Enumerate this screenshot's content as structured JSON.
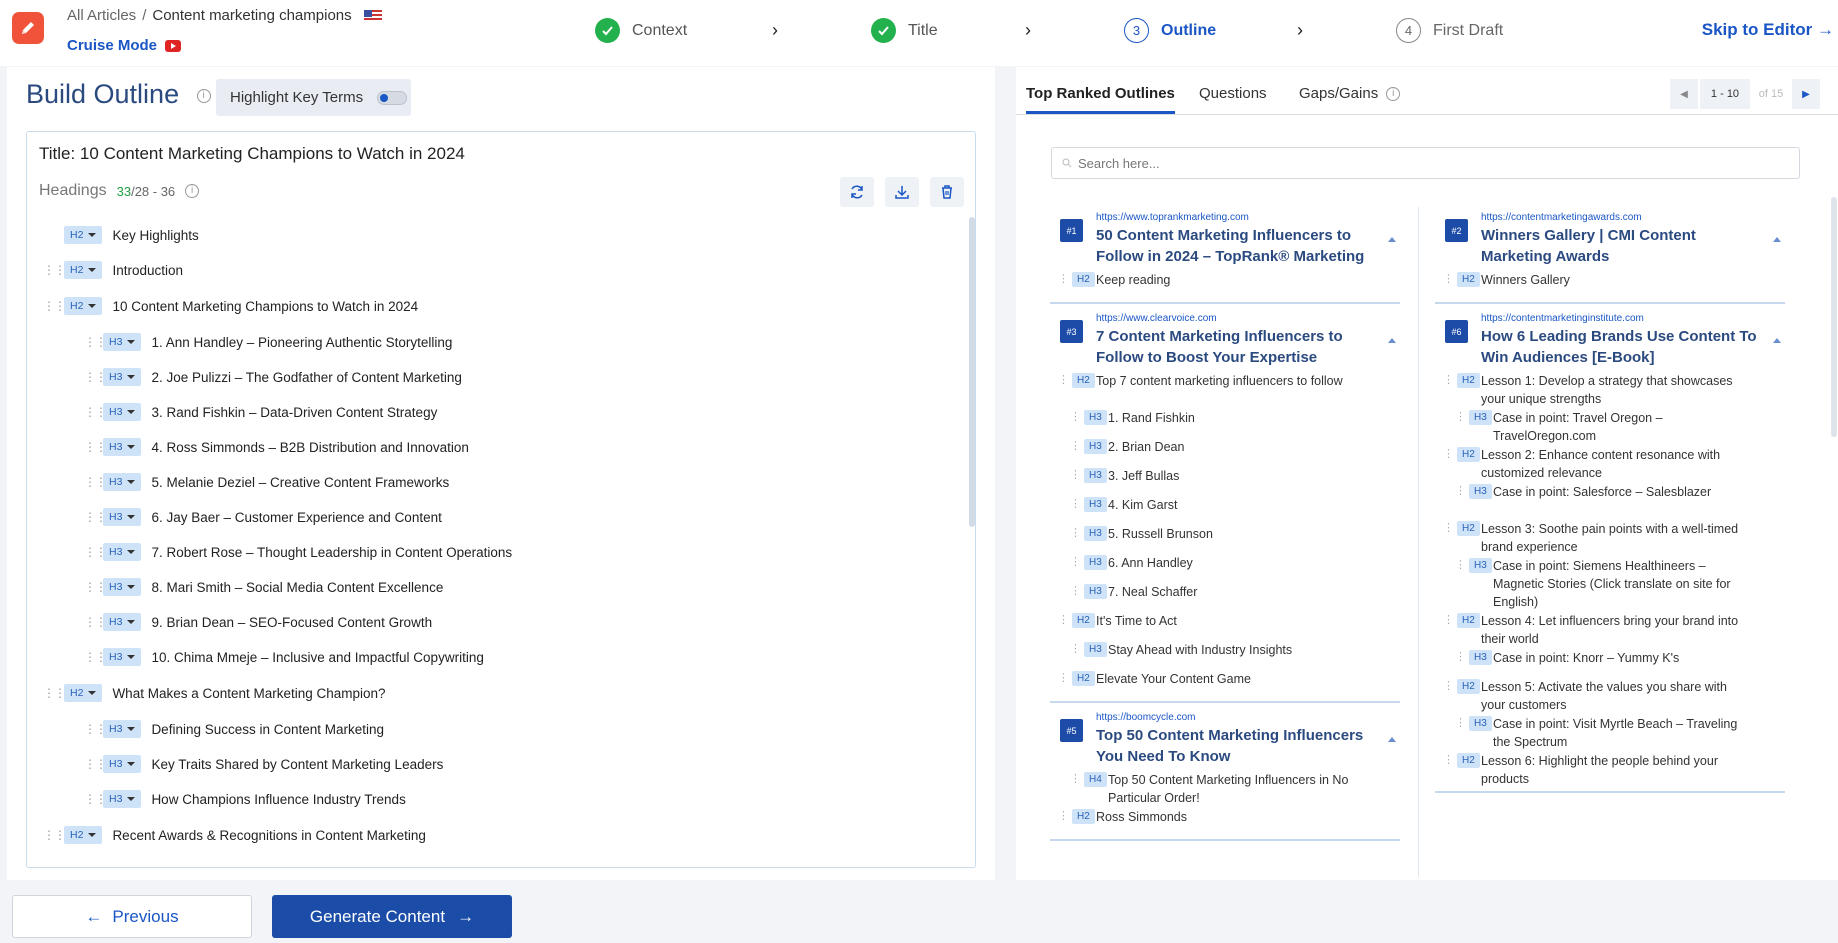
{
  "breadcrumb": {
    "root": "All Articles",
    "sep": "/",
    "current": "Content marketing champions"
  },
  "cruise_mode": "Cruise Mode",
  "steps": [
    {
      "label": "Context",
      "state": "done"
    },
    {
      "label": "Title",
      "state": "done"
    },
    {
      "num": "3",
      "label": "Outline",
      "state": "active"
    },
    {
      "num": "4",
      "label": "First Draft",
      "state": "pending"
    }
  ],
  "skip_label": "Skip to Editor →",
  "build": {
    "title": "Build Outline",
    "highlight_label": "Highlight Key Terms",
    "outline_title": "Title: 10 Content Marketing Champions to Watch in 2024",
    "headings_label": "Headings",
    "headings_count": "33",
    "headings_range": "/28 - 36"
  },
  "outline": [
    {
      "level": "H2",
      "text": "Key Highlights"
    },
    {
      "level": "H2",
      "text": "Introduction"
    },
    {
      "level": "H2",
      "text": "10 Content Marketing Champions to Watch in 2024"
    },
    {
      "level": "H3",
      "text": "1. Ann Handley – Pioneering Authentic Storytelling"
    },
    {
      "level": "H3",
      "text": "2. Joe Pulizzi – The Godfather of Content Marketing"
    },
    {
      "level": "H3",
      "text": "3. Rand Fishkin – Data-Driven Content Strategy"
    },
    {
      "level": "H3",
      "text": "4. Ross Simmonds – B2B Distribution and Innovation"
    },
    {
      "level": "H3",
      "text": "5. Melanie Deziel – Creative Content Frameworks"
    },
    {
      "level": "H3",
      "text": "6. Jay Baer – Customer Experience and Content"
    },
    {
      "level": "H3",
      "text": "7. Robert Rose – Thought Leadership in Content Operations"
    },
    {
      "level": "H3",
      "text": "8. Mari Smith – Social Media Content Excellence"
    },
    {
      "level": "H3",
      "text": "9. Brian Dean – SEO-Focused Content Growth"
    },
    {
      "level": "H3",
      "text": "10. Chima Mmeje – Inclusive and Impactful Copywriting"
    },
    {
      "level": "H2",
      "text": "What Makes a Content Marketing Champion?"
    },
    {
      "level": "H3",
      "text": "Defining Success in Content Marketing"
    },
    {
      "level": "H3",
      "text": "Key Traits Shared by Content Marketing Leaders"
    },
    {
      "level": "H3",
      "text": "How Champions Influence Industry Trends"
    },
    {
      "level": "H2",
      "text": "Recent Awards & Recognitions in Content Marketing"
    }
  ],
  "right": {
    "tabs": [
      "Top Ranked Outlines",
      "Questions",
      "Gaps/Gains"
    ],
    "pager": {
      "range": "1 - 10",
      "of": "of 15"
    },
    "search_placeholder": "Search here..."
  },
  "cards_left": [
    {
      "rank": "#1",
      "url": "https://www.toprankmarketing.com",
      "title": "50 Content Marketing Influencers to Follow in 2024 – TopRank® Marketing",
      "items": [
        {
          "level": "H2",
          "text": "Keep reading"
        }
      ]
    },
    {
      "rank": "#3",
      "url": "https://www.clearvoice.com",
      "title": "7 Content Marketing Influencers to Follow to Boost Your Expertise",
      "items": [
        {
          "level": "H2",
          "text": "Top 7 content marketing influencers to follow"
        },
        {
          "level": "H3",
          "text": "1. Rand Fishkin"
        },
        {
          "level": "H3",
          "text": "2. Brian Dean"
        },
        {
          "level": "H3",
          "text": "3. Jeff Bullas"
        },
        {
          "level": "H3",
          "text": "4. Kim Garst"
        },
        {
          "level": "H3",
          "text": "5. Russell Brunson"
        },
        {
          "level": "H3",
          "text": "6. Ann Handley"
        },
        {
          "level": "H3",
          "text": "7. Neal Schaffer"
        },
        {
          "level": "H2",
          "text": "It's Time to Act"
        },
        {
          "level": "H3",
          "text": "Stay Ahead with Industry Insights"
        },
        {
          "level": "H2",
          "text": "Elevate Your Content Game"
        }
      ]
    },
    {
      "rank": "#5",
      "url": "https://boomcycle.com",
      "title": "Top 50 Content Marketing Influencers You Need To Know",
      "items": [
        {
          "level": "H4",
          "text": "Top 50 Content Marketing Influencers in No Particular Order!"
        },
        {
          "level": "H2",
          "text": "Ross Simmonds"
        }
      ]
    }
  ],
  "cards_right": [
    {
      "rank": "#2",
      "url": "https://contentmarketingawards.com",
      "title": "Winners Gallery | CMI Content Marketing Awards",
      "items": [
        {
          "level": "H2",
          "text": "Winners Gallery"
        }
      ]
    },
    {
      "rank": "#6",
      "url": "https://contentmarketinginstitute.com",
      "title": "How 6 Leading Brands Use Content To Win Audiences [E-Book]",
      "items": [
        {
          "level": "H2",
          "text": "Lesson 1: Develop a strategy that showcases your unique strengths"
        },
        {
          "level": "H3",
          "text": "Case in point: Travel Oregon – TravelOregon.com"
        },
        {
          "level": "H2",
          "text": "Lesson 2: Enhance content resonance with customized relevance"
        },
        {
          "level": "H3",
          "text": "Case in point: Salesforce – Salesblazer"
        },
        {
          "level": "H2",
          "text": "Lesson 3: Soothe pain points with a well-timed brand experience"
        },
        {
          "level": "H3",
          "text": "Case in point: Siemens Healthineers – Magnetic Stories (Click translate on site for English)"
        },
        {
          "level": "H2",
          "text": "Lesson 4: Let influencers bring your brand into their world"
        },
        {
          "level": "H3",
          "text": "Case in point: Knorr – Yummy K's"
        },
        {
          "level": "H2",
          "text": "Lesson 5: Activate the values you share with your customers"
        },
        {
          "level": "H3",
          "text": "Case in point: Visit Myrtle Beach – Traveling the Spectrum"
        },
        {
          "level": "H2",
          "text": "Lesson 6: Highlight the people behind your products"
        }
      ]
    }
  ],
  "footer": {
    "prev_label": "Previous",
    "generate_label": "Generate Content"
  },
  "colors": {
    "accent": "#1a56c5",
    "success": "#22b14c",
    "brand": "#f0533a",
    "button": "#1a4ca8"
  },
  "icons": [
    "pen-logo-icon",
    "us-flag-icon",
    "youtube-icon",
    "check-circle-icon",
    "chevron-right-icon",
    "info-icon",
    "refresh-icon",
    "download-icon",
    "trash-icon",
    "drag-handle-icon",
    "search-icon",
    "caret-up-icon",
    "arrow-left-icon",
    "arrow-right-icon"
  ]
}
